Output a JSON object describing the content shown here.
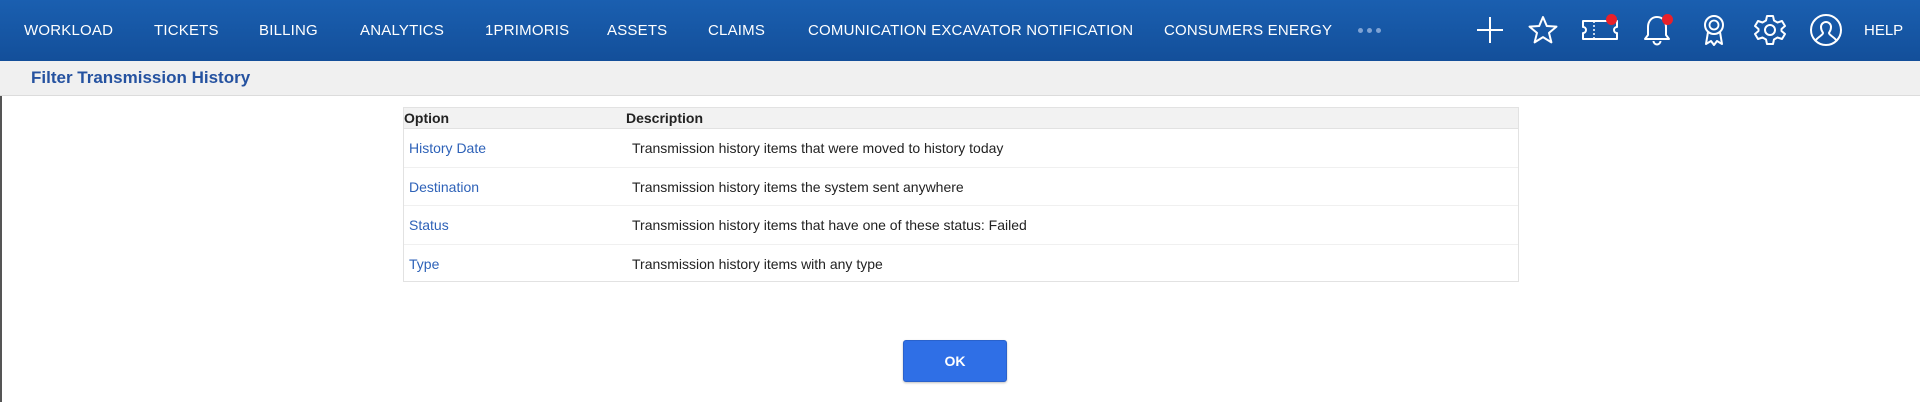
{
  "nav": {
    "items": [
      {
        "id": "workload",
        "label": "WORKLOAD"
      },
      {
        "id": "tickets",
        "label": "TICKETS"
      },
      {
        "id": "billing",
        "label": "BILLING"
      },
      {
        "id": "analytics",
        "label": "ANALYTICS"
      },
      {
        "id": "1primoris",
        "label": "1PRIMORIS"
      },
      {
        "id": "assets",
        "label": "ASSETS"
      },
      {
        "id": "claims",
        "label": "CLAIMS"
      },
      {
        "id": "comunication",
        "label": "COMUNICATION EXCAVATOR NOTIFICATION"
      },
      {
        "id": "consumers",
        "label": "CONSUMERS ENERGY"
      }
    ],
    "more_icon": "more-dots-icon",
    "icons": [
      "plus-icon",
      "star-icon",
      "ticket-icon",
      "bell-icon",
      "award-icon",
      "gear-icon",
      "user-icon"
    ],
    "help_label": "HELP",
    "badge_color": "#e8202a",
    "bar_color": "#1a5fb0"
  },
  "page": {
    "title": "Filter Transmission History"
  },
  "table": {
    "headers": {
      "option": "Option",
      "description": "Description"
    },
    "rows": [
      {
        "option": "History Date",
        "description": "Transmission history items that were moved to history today"
      },
      {
        "option": "Destination",
        "description": "Transmission history items the system sent anywhere"
      },
      {
        "option": "Status",
        "description": "Transmission history items that have one of these status: Failed"
      },
      {
        "option": "Type",
        "description": "Transmission history items with any type"
      }
    ]
  },
  "actions": {
    "ok_label": "OK",
    "ok_color": "#2f6fe6"
  }
}
